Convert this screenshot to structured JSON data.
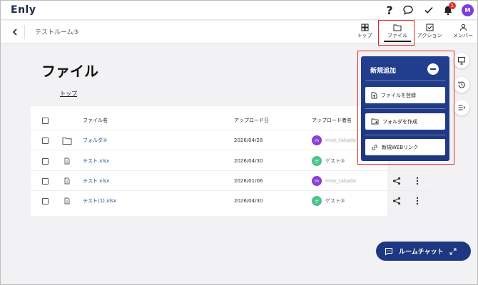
{
  "app": {
    "logo": "Enly",
    "room_name": "テストルーム③",
    "notification_count": "1",
    "user_initial": "M"
  },
  "tabs": [
    {
      "label": "トップ",
      "icon": "grid-icon"
    },
    {
      "label": "ファイル",
      "icon": "folder-icon",
      "active": true
    },
    {
      "label": "アクション",
      "icon": "checkbox-icon"
    },
    {
      "label": "メンバー",
      "icon": "person-icon"
    }
  ],
  "page": {
    "title": "ファイル",
    "breadcrumb": "トップ"
  },
  "table": {
    "headers": {
      "name": "ファイル名",
      "date": "アップロード日",
      "uploader": "アップロード者名"
    },
    "rows": [
      {
        "type": "folder",
        "name": "フォルダ①",
        "date": "2026/04/28",
        "uploader": "moe_takada",
        "avatar": "m",
        "avatar_color": "#8a3fd6"
      },
      {
        "type": "file",
        "name": "テスト.xlsx",
        "date": "2026/04/30",
        "uploader": "ゲスト③",
        "avatar": "ゲ",
        "avatar_color": "#4cc38a"
      },
      {
        "type": "file",
        "name": "テスト.xlsx",
        "date": "2026/01/06",
        "uploader": "moe_takada",
        "avatar": "m",
        "avatar_color": "#8a3fd6"
      },
      {
        "type": "file",
        "name": "テスト(1).xlsx",
        "date": "2026/04/30",
        "uploader": "ゲスト③",
        "avatar": "ゲ",
        "avatar_color": "#4cc38a"
      }
    ]
  },
  "popup": {
    "title": "新規追加",
    "items": [
      {
        "label": "ファイルを登録",
        "icon": "file-upload-icon"
      },
      {
        "label": "フォルダを作成",
        "icon": "folder-add-icon"
      },
      {
        "label": "新規WEBリンク",
        "icon": "link-icon"
      }
    ]
  },
  "chat_button": {
    "label": "ルームチャット"
  },
  "colors": {
    "accent": "#1d3781",
    "highlight": "#e32626"
  }
}
